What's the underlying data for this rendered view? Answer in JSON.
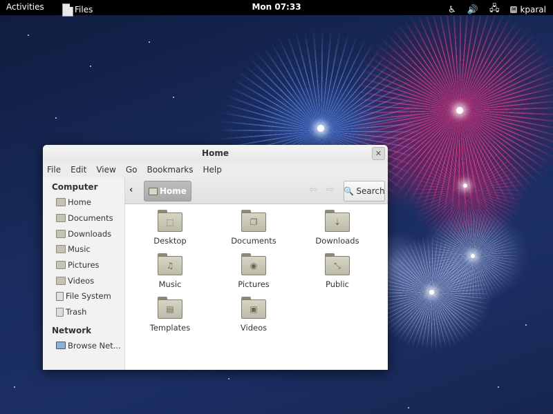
{
  "topbar": {
    "activities": "Activities",
    "app_name": "Files",
    "clock": "Mon 07:33",
    "user": "kparal"
  },
  "window": {
    "title": "Home",
    "menu": [
      "File",
      "Edit",
      "View",
      "Go",
      "Bookmarks",
      "Help"
    ]
  },
  "sidebar": {
    "computer_heading": "Computer",
    "computer_items": [
      {
        "label": "Home",
        "icon": "home-folder-icon"
      },
      {
        "label": "Documents",
        "icon": "documents-folder-icon"
      },
      {
        "label": "Downloads",
        "icon": "downloads-folder-icon"
      },
      {
        "label": "Music",
        "icon": "music-folder-icon"
      },
      {
        "label": "Pictures",
        "icon": "pictures-folder-icon"
      },
      {
        "label": "Videos",
        "icon": "videos-folder-icon"
      },
      {
        "label": "File System",
        "icon": "drive-icon"
      },
      {
        "label": "Trash",
        "icon": "trash-icon"
      }
    ],
    "network_heading": "Network",
    "network_items": [
      {
        "label": "Browse Net...",
        "icon": "network-icon"
      }
    ]
  },
  "toolbar": {
    "path": "Home",
    "search_label": "Search"
  },
  "files": [
    {
      "label": "Desktop",
      "glyph": "⬚"
    },
    {
      "label": "Documents",
      "glyph": "❐"
    },
    {
      "label": "Downloads",
      "glyph": "⇣"
    },
    {
      "label": "Music",
      "glyph": "♫"
    },
    {
      "label": "Pictures",
      "glyph": "◉"
    },
    {
      "label": "Public",
      "glyph": "⤡"
    },
    {
      "label": "Templates",
      "glyph": "▤"
    },
    {
      "label": "Videos",
      "glyph": "▣"
    }
  ]
}
